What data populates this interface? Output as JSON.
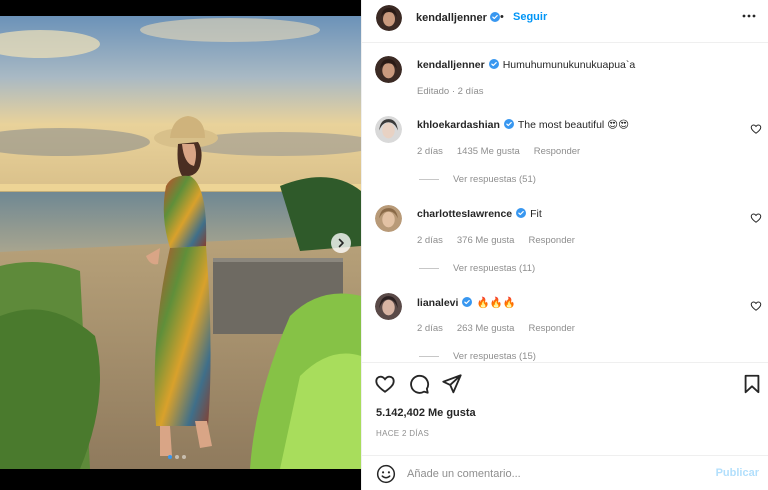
{
  "post": {
    "author": "kendalljenner",
    "follow_label": "Seguir",
    "bullet": "•",
    "caption": "Humuhumunukunukuapua`a",
    "caption_meta": "Editado · 2 días",
    "likes": "5.142,402 Me gusta",
    "date": "HACE 2 DÍAS"
  },
  "carousel": {
    "count": 3,
    "active_index": 0
  },
  "comments": [
    {
      "user": "khloekardashian",
      "text": "The most beautiful 😍😍",
      "time": "2 días",
      "likes": "1435 Me gusta",
      "reply_label": "Responder",
      "view_replies": "Ver respuestas (51)"
    },
    {
      "user": "charlottesIawrence",
      "text": "Fit",
      "time": "2 días",
      "likes": "376 Me gusta",
      "reply_label": "Responder",
      "view_replies": "Ver respuestas (11)"
    },
    {
      "user": "lianalevi",
      "text": "🔥🔥🔥",
      "time": "2 días",
      "likes": "263 Me gusta",
      "reply_label": "Responder",
      "view_replies": "Ver respuestas (15)"
    }
  ],
  "composer": {
    "placeholder": "Añade un comentario...",
    "value": "",
    "post_label": "Publicar"
  },
  "icons": {
    "more": "more-icon",
    "like": "heart-icon",
    "comment": "comment-icon",
    "share": "send-icon",
    "save": "bookmark-icon",
    "emoji": "emoji-icon",
    "next": "chevron-right-icon",
    "verified": "verified-badge-icon"
  },
  "colors": {
    "accent": "#0095f6",
    "verified": "#3897f0",
    "muted": "#8e8e8e",
    "publish_disabled": "#b2dffc",
    "active_dot": "#3797f0"
  }
}
